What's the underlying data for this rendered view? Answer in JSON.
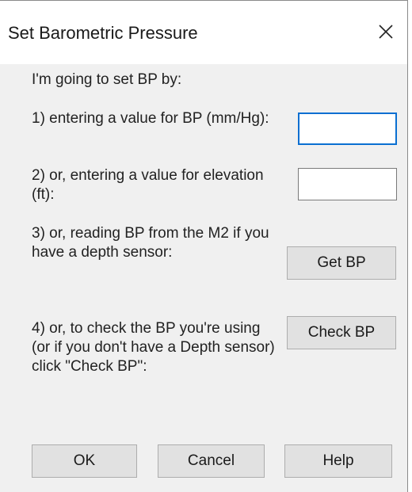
{
  "dialog": {
    "title": "Set Barometric Pressure",
    "close_icon": "close-icon"
  },
  "content": {
    "intro": "I'm going to set BP by:",
    "option1": "1) entering a value for BP (mm/Hg):",
    "option2": "2) or, entering a value for elevation (ft):",
    "option3": "3) or, reading BP from the M2 if you have a depth sensor:",
    "option4": "4) or, to check the BP you're using (or if you don't have a Depth sensor) click \"Check BP\":"
  },
  "inputs": {
    "bp_value": "",
    "elevation_value": ""
  },
  "buttons": {
    "get_bp": "Get BP",
    "check_bp": "Check BP",
    "ok": "OK",
    "cancel": "Cancel",
    "help": "Help"
  },
  "colors": {
    "focus_border": "#0a6fd1",
    "dialog_bg": "#f0f0f0",
    "button_bg": "#e1e1e1"
  }
}
